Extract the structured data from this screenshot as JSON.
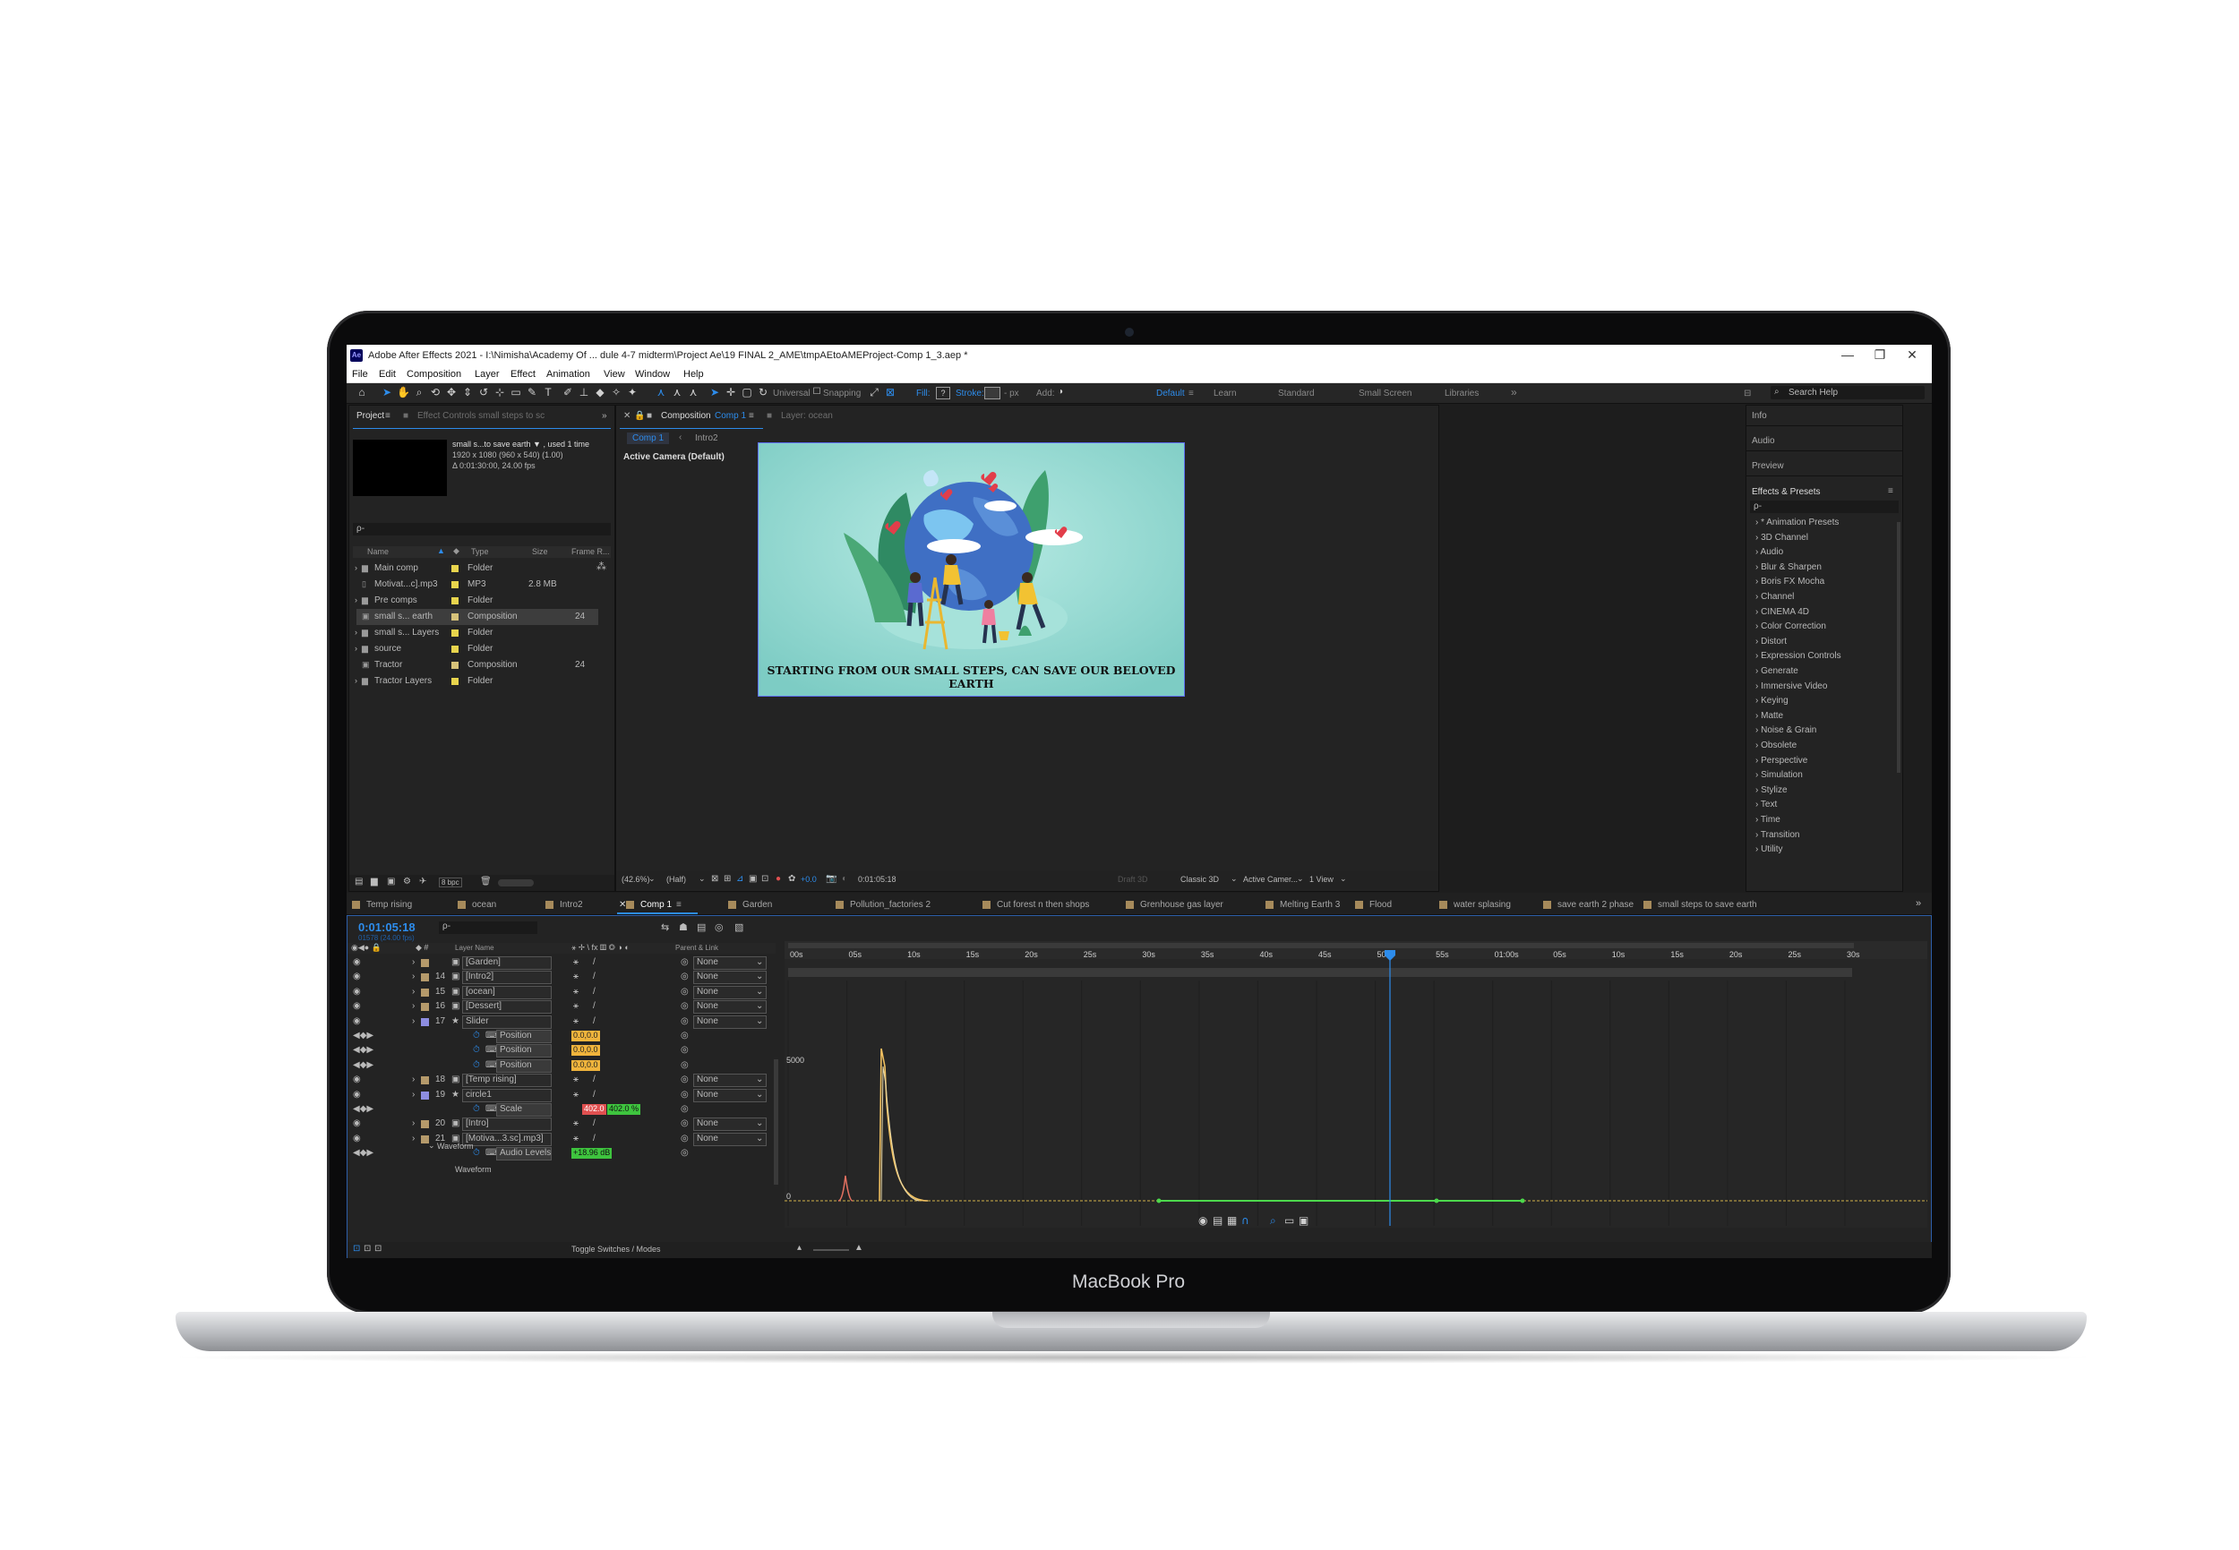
{
  "device": {
    "brand": "MacBook Pro"
  },
  "window": {
    "app_icon": "Ae",
    "title": "Adobe After Effects 2021 - I:\\Nimisha\\Academy Of ... dule 4-7 midterm\\Project Ae\\19 FINAL 2_AME\\tmpAEtoAMEProject-Comp 1_3.aep *",
    "controls": [
      "—",
      "❐",
      "✕"
    ]
  },
  "menu": [
    "File",
    "Edit",
    "Composition",
    "Layer",
    "Effect",
    "Animation",
    "View",
    "Window",
    "Help"
  ],
  "toolbar": {
    "universal": "Universal",
    "snapping": "Snapping",
    "fill": "Fill:",
    "stroke": "Stroke:",
    "px": "- px",
    "add": "Add:",
    "workspaces": [
      "Default",
      "Learn",
      "Standard",
      "Small Screen",
      "Libraries"
    ],
    "search_placeholder": "Search Help"
  },
  "project_panel": {
    "tab": "Project",
    "tab2": "Effect Controls small steps to sc",
    "item_name": "small s...to save earth ▼ , used 1 time",
    "item_info1": "1920 x 1080  (960 x 540) (1.00)",
    "item_info2": "Δ 0:01:30:00, 24.00 fps",
    "search_placeholder": "ρ-",
    "columns": [
      "Name",
      "Type",
      "Size",
      "Frame R..."
    ],
    "rows": [
      {
        "name": "Main comp",
        "type": "Folder",
        "size": "",
        "fr": "",
        "color": "#e8d44d",
        "selected": false
      },
      {
        "name": "Motivat...c].mp3",
        "type": "MP3",
        "size": "2.8 MB",
        "fr": "",
        "color": "#e8d44d",
        "selected": false
      },
      {
        "name": "Pre comps",
        "type": "Folder",
        "size": "",
        "fr": "",
        "color": "#e8d44d",
        "selected": false
      },
      {
        "name": "small s... earth",
        "type": "Composition",
        "size": "",
        "fr": "24",
        "color": "#d6c27a",
        "selected": true
      },
      {
        "name": "small s... Layers",
        "type": "Folder",
        "size": "",
        "fr": "",
        "color": "#e8d44d",
        "selected": false
      },
      {
        "name": "source",
        "type": "Folder",
        "size": "",
        "fr": "",
        "color": "#e8d44d",
        "selected": false
      },
      {
        "name": "Tractor",
        "type": "Composition",
        "size": "",
        "fr": "24",
        "color": "#d6c27a",
        "selected": false
      },
      {
        "name": "Tractor Layers",
        "type": "Folder",
        "size": "",
        "fr": "",
        "color": "#e8d44d",
        "selected": false
      }
    ],
    "bpc": "8 bpc"
  },
  "comp_panel": {
    "tab": "Composition",
    "tab_comp": "Comp 1",
    "layer_tab": "Layer: ocean",
    "flow": [
      "Comp 1",
      "Intro2"
    ],
    "camera": "Active Camera (Default)",
    "caption": "STARTING FROM OUR SMALL STEPS, CAN SAVE OUR BELOVED EARTH",
    "bg_color": "#8fd6cf",
    "zoom": "(42.6%)",
    "quality": "(Half)",
    "exposure": "+0.0",
    "timecode": "0:01:05:18",
    "draft": "Draft 3D",
    "renderer": "Classic 3D",
    "camera_sel": "Active Camer...",
    "view": "1 View"
  },
  "right_panel": {
    "items": [
      "Info",
      "Audio",
      "Preview"
    ],
    "effects_title": "Effects & Presets",
    "search_placeholder": "ρ-",
    "categories": [
      "* Animation Presets",
      "3D Channel",
      "Audio",
      "Blur & Sharpen",
      "Boris FX Mocha",
      "Channel",
      "CINEMA 4D",
      "Color Correction",
      "Distort",
      "Expression Controls",
      "Generate",
      "Immersive Video",
      "Keying",
      "Matte",
      "Noise & Grain",
      "Obsolete",
      "Perspective",
      "Simulation",
      "Stylize",
      "Text",
      "Time",
      "Transition",
      "Utility"
    ]
  },
  "timeline": {
    "tabs": [
      {
        "label": "Temp rising",
        "color": "#a68a5b"
      },
      {
        "label": "ocean",
        "color": "#a68a5b"
      },
      {
        "label": "Intro2",
        "color": "#a68a5b"
      },
      {
        "label": "Comp 1",
        "color": "#a68a5b",
        "active": true
      },
      {
        "label": "Garden",
        "color": "#a68a5b"
      },
      {
        "label": "Pollution_factories 2",
        "color": "#a68a5b"
      },
      {
        "label": "Cut forest n then shops",
        "color": "#a68a5b"
      },
      {
        "label": "Grenhouse gas layer",
        "color": "#a68a5b"
      },
      {
        "label": "Melting Earth 3",
        "color": "#a68a5b"
      },
      {
        "label": "Flood",
        "color": "#a68a5b"
      },
      {
        "label": "water splasing",
        "color": "#a68a5b"
      },
      {
        "label": "save earth 2 phase",
        "color": "#a68a5b"
      },
      {
        "label": "small steps to save earth",
        "color": "#a68a5b"
      }
    ],
    "timecode": "0:01:05:18",
    "frames": "01578 (24.00 fps)",
    "columns": {
      "layer_name": "Layer Name",
      "parent": "Parent & Link"
    },
    "layers": [
      {
        "num": "",
        "name": "[Garden]",
        "parent": "None"
      },
      {
        "num": "14",
        "name": "[Intro2]",
        "parent": "None"
      },
      {
        "num": "15",
        "name": "[ocean]",
        "parent": "None"
      },
      {
        "num": "16",
        "name": "[Dessert]",
        "parent": "None"
      },
      {
        "num": "17",
        "name": "Slider",
        "parent": "None"
      },
      {
        "num": "",
        "name": "Position",
        "value": "0.0,0.0",
        "prop": true
      },
      {
        "num": "",
        "name": "Position",
        "value": "0.0,0.0",
        "prop": true
      },
      {
        "num": "",
        "name": "Position",
        "value": "0.0,0.0",
        "prop": true
      },
      {
        "num": "18",
        "name": "[Temp rising]",
        "parent": "None"
      },
      {
        "num": "19",
        "name": "circle1",
        "parent": "None"
      },
      {
        "num": "",
        "name": "Scale",
        "value": "402.0",
        "value2": "402.0 %",
        "prop": true
      },
      {
        "num": "20",
        "name": "[Intro]",
        "parent": "None"
      },
      {
        "num": "21",
        "name": "[Motiva...3.sc].mp3]",
        "parent": "None"
      },
      {
        "num": "",
        "name": "Audio Levels",
        "value": "+18.96 dB",
        "prop": true
      }
    ],
    "waveform_label": "Waveform",
    "waveform_sub": "Waveform",
    "toggle": "Toggle Switches / Modes",
    "ruler": [
      "00s",
      "05s",
      "10s",
      "15s",
      "20s",
      "25s",
      "30s",
      "35s",
      "40s",
      "45s",
      "50s",
      "55s",
      "01:00s",
      "05s",
      "10s",
      "15s",
      "20s",
      "25s",
      "30s"
    ],
    "graph_value_label": "5000",
    "graph_zero_label": "0"
  }
}
